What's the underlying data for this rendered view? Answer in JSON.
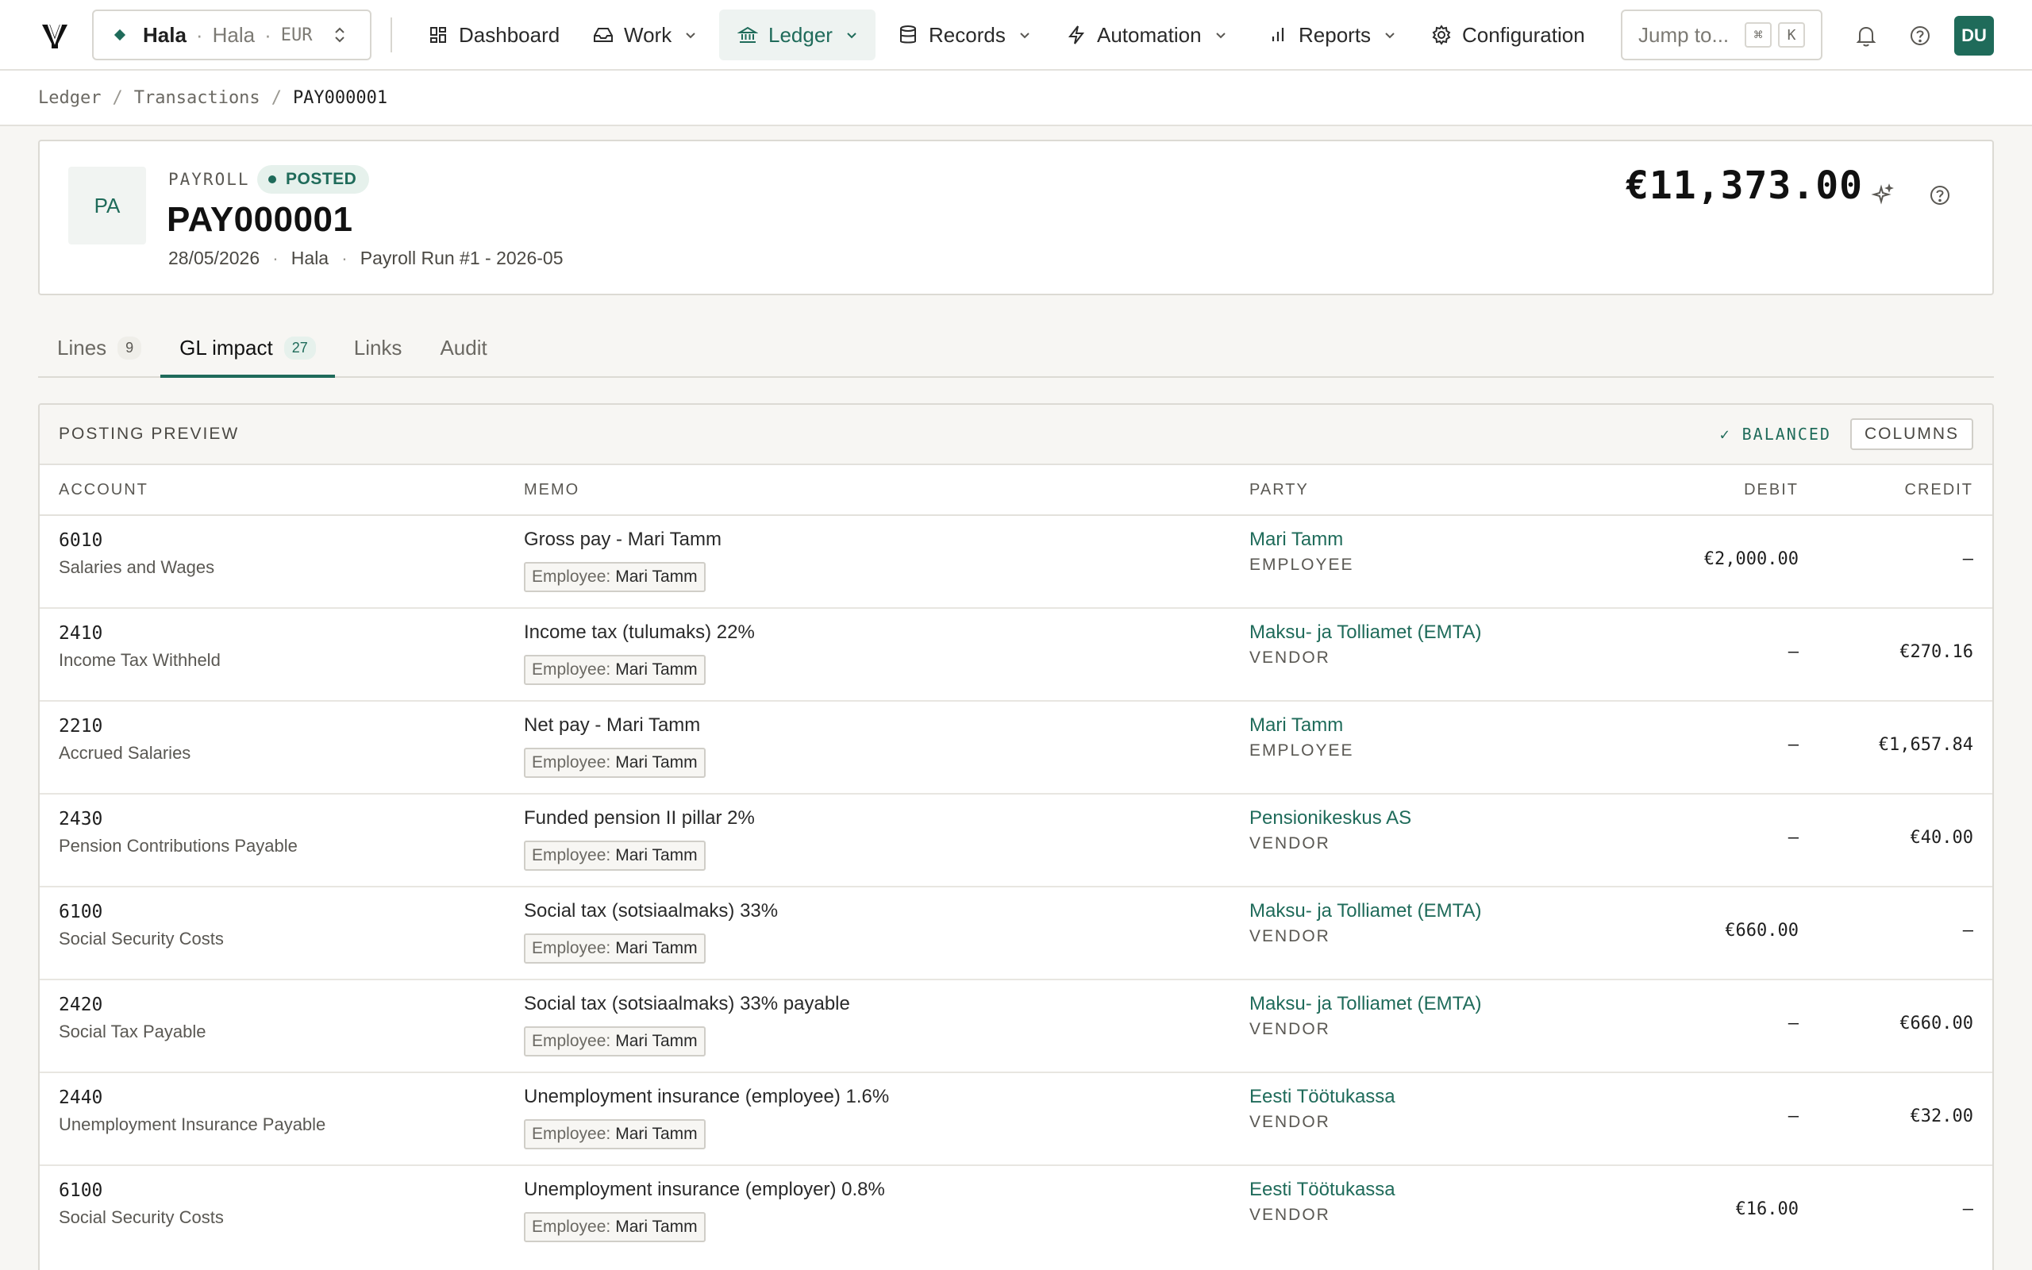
{
  "nav": {
    "org_name": "Hala",
    "org_sub": "Hala",
    "org_currency": "EUR",
    "items": [
      {
        "label": "Dashboard"
      },
      {
        "label": "Work"
      },
      {
        "label": "Ledger"
      },
      {
        "label": "Records"
      },
      {
        "label": "Automation"
      },
      {
        "label": "Reports"
      },
      {
        "label": "Configuration"
      }
    ],
    "active": "Ledger",
    "jump_placeholder": "Jump to...",
    "jump_kbd_1": "⌘",
    "jump_kbd_2": "K",
    "avatar_initials": "DU"
  },
  "breadcrumb": {
    "items": [
      "Ledger",
      "Transactions",
      "PAY000001"
    ]
  },
  "document": {
    "badge": "PA",
    "type": "PAYROLL",
    "status": "POSTED",
    "id": "PAY000001",
    "date": "28/05/2026",
    "entity": "Hala",
    "reference": "Payroll Run #1 - 2026-05",
    "amount": "€11,373.00"
  },
  "tabs": [
    {
      "label": "Lines",
      "count": "9"
    },
    {
      "label": "GL impact",
      "count": "27"
    },
    {
      "label": "Links",
      "count": ""
    },
    {
      "label": "Audit",
      "count": ""
    }
  ],
  "active_tab": "GL impact",
  "preview": {
    "title": "POSTING PREVIEW",
    "balanced_label": "✓ BALANCED",
    "columns_label": "COLUMNS",
    "headers": {
      "account": "ACCOUNT",
      "memo": "MEMO",
      "party": "PARTY",
      "debit": "DEBIT",
      "credit": "CREDIT"
    },
    "tag_label": "Employee:",
    "rows": [
      {
        "code": "6010",
        "account": "Salaries and Wages",
        "memo": "Gross pay - Mari Tamm",
        "tag_value": "Mari Tamm",
        "party": "Mari Tamm",
        "party_type": "EMPLOYEE",
        "debit": "€2,000.00",
        "credit": "—"
      },
      {
        "code": "2410",
        "account": "Income Tax Withheld",
        "memo": "Income tax (tulumaks) 22%",
        "tag_value": "Mari Tamm",
        "party": "Maksu- ja Tolliamet (EMTA)",
        "party_type": "VENDOR",
        "debit": "—",
        "credit": "€270.16"
      },
      {
        "code": "2210",
        "account": "Accrued Salaries",
        "memo": "Net pay - Mari Tamm",
        "tag_value": "Mari Tamm",
        "party": "Mari Tamm",
        "party_type": "EMPLOYEE",
        "debit": "—",
        "credit": "€1,657.84"
      },
      {
        "code": "2430",
        "account": "Pension Contributions Payable",
        "memo": "Funded pension II pillar 2%",
        "tag_value": "Mari Tamm",
        "party": "Pensionikeskus AS",
        "party_type": "VENDOR",
        "debit": "—",
        "credit": "€40.00"
      },
      {
        "code": "6100",
        "account": "Social Security Costs",
        "memo": "Social tax (sotsiaalmaks) 33%",
        "tag_value": "Mari Tamm",
        "party": "Maksu- ja Tolliamet (EMTA)",
        "party_type": "VENDOR",
        "debit": "€660.00",
        "credit": "—"
      },
      {
        "code": "2420",
        "account": "Social Tax Payable",
        "memo": "Social tax (sotsiaalmaks) 33% payable",
        "tag_value": "Mari Tamm",
        "party": "Maksu- ja Tolliamet (EMTA)",
        "party_type": "VENDOR",
        "debit": "—",
        "credit": "€660.00"
      },
      {
        "code": "2440",
        "account": "Unemployment Insurance Payable",
        "memo": "Unemployment insurance (employee) 1.6%",
        "tag_value": "Mari Tamm",
        "party": "Eesti Töötukassa",
        "party_type": "VENDOR",
        "debit": "—",
        "credit": "€32.00"
      },
      {
        "code": "6100",
        "account": "Social Security Costs",
        "memo": "Unemployment insurance (employer) 0.8%",
        "tag_value": "Mari Tamm",
        "party": "Eesti Töötukassa",
        "party_type": "VENDOR",
        "debit": "€16.00",
        "credit": "—"
      }
    ]
  },
  "colors": {
    "accent": "#1f6b5a",
    "accent_bg": "#e6f1ec",
    "page_bg": "#f7f6f3"
  }
}
